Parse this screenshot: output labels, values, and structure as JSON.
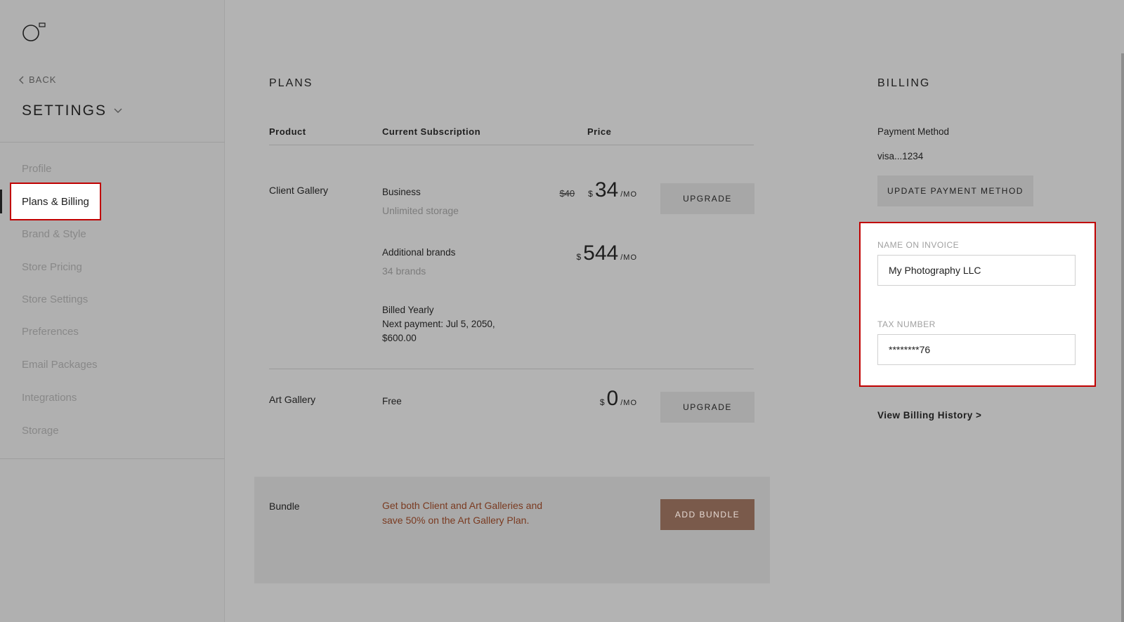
{
  "sidebar": {
    "back_label": "BACK",
    "title": "SETTINGS",
    "items": [
      {
        "label": "Profile",
        "active": false
      },
      {
        "label": "Plans & Billing",
        "active": true
      },
      {
        "label": "Brand & Style",
        "active": false
      },
      {
        "label": "Store Pricing",
        "active": false
      },
      {
        "label": "Store Settings",
        "active": false
      },
      {
        "label": "Preferences",
        "active": false
      },
      {
        "label": "Email Packages",
        "active": false
      },
      {
        "label": "Integrations",
        "active": false
      },
      {
        "label": "Storage",
        "active": false
      }
    ]
  },
  "plans": {
    "title": "PLANS",
    "columns": {
      "product": "Product",
      "subscription": "Current Subscription",
      "price": "Price"
    },
    "client_gallery": {
      "product": "Client Gallery",
      "plan_name": "Business",
      "plan_detail": "Unlimited storage",
      "old_price": "$40",
      "currency": "$",
      "price": "34",
      "period": "/MO",
      "upgrade_label": "UPGRADE",
      "addon_name": "Additional brands",
      "addon_detail": "34 brands",
      "addon_currency": "$",
      "addon_price": "544",
      "addon_period": "/MO",
      "billing_cycle": "Billed Yearly",
      "next_payment_line1": "Next payment: Jul 5, 2050,",
      "next_payment_line2": "$600.00"
    },
    "art_gallery": {
      "product": "Art Gallery",
      "plan_name": "Free",
      "currency": "$",
      "price": "0",
      "period": "/MO",
      "upgrade_label": "UPGRADE"
    },
    "bundle": {
      "product": "Bundle",
      "description": "Get both Client and Art Galleries and save 50% on the Art Gallery Plan.",
      "button_label": "ADD BUNDLE"
    }
  },
  "billing": {
    "title": "BILLING",
    "payment_method_label": "Payment Method",
    "payment_method_value": "visa...1234",
    "update_button": "UPDATE PAYMENT METHOD",
    "name_label": "NAME ON INVOICE",
    "name_value": "My Photography LLC",
    "tax_label": "TAX NUMBER",
    "tax_value": "********76",
    "history_link": "View Billing History >"
  },
  "colors": {
    "background": "#b3b3b3",
    "highlight_border": "#c00000",
    "bundle_button": "#7a5a4b",
    "bundle_text": "#7a3a20"
  }
}
